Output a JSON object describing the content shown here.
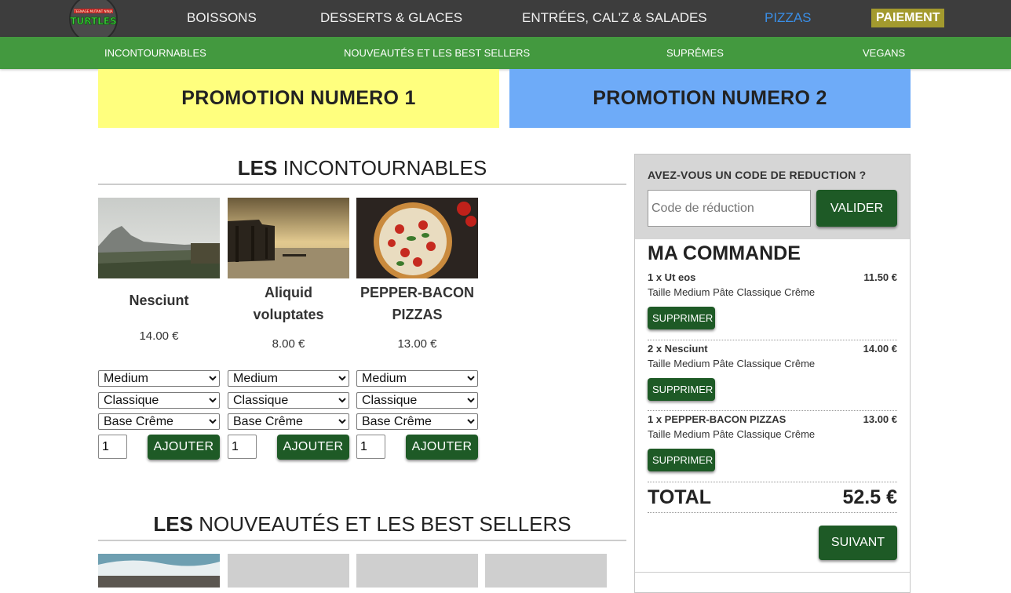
{
  "nav": {
    "items": [
      "BOISSONS",
      "DESSERTS & GLACES",
      "ENTRÉES, CAL'Z & SALADES",
      "PIZZAS"
    ],
    "active": "PIZZAS",
    "pay_label": "PAIEMENT",
    "logo_text": "TURTLES",
    "logo_subtext": "TEENAGE MUTANT NINJA"
  },
  "subnav": {
    "items": [
      "INCONTOURNABLES",
      "NOUVEAUTÉS ET LES BEST SELLERS",
      "SUPRÊMES",
      "VEGANS"
    ]
  },
  "promos": [
    "PROMOTION NUMERO 1",
    "PROMOTION NUMERO 2"
  ],
  "sections": [
    {
      "prefix": "LES",
      "name": "INCONTOURNABLES"
    },
    {
      "prefix": "LES",
      "name": "NOUVEAUTÉS ET LES BEST SELLERS"
    }
  ],
  "products": [
    {
      "name": "Nesciunt",
      "price": "14.00 €",
      "size": "Medium",
      "dough": "Classique",
      "base": "Base Crême",
      "qty": "1",
      "add_label": "AJOUTER",
      "image": "mountain-landscape"
    },
    {
      "name": "Aliquid voluptates",
      "price": "8.00 €",
      "size": "Medium",
      "dough": "Classique",
      "base": "Base Crême",
      "qty": "1",
      "add_label": "AJOUTER",
      "image": "pier-sunset"
    },
    {
      "name": "PEPPER-BACON PIZZAS",
      "price": "13.00 €",
      "size": "Medium",
      "dough": "Classique",
      "base": "Base Crême",
      "qty": "1",
      "add_label": "AJOUTER",
      "image": "pizza"
    }
  ],
  "coupon": {
    "question": "AVEZ-VOUS UN CODE DE REDUCTION ?",
    "placeholder": "Code de réduction",
    "button": "VALIDER"
  },
  "order": {
    "title": "MA COMMANDE",
    "lines": [
      {
        "title": "1 x Ut eos",
        "price": "11.50 €",
        "details": "Taille Medium Pâte Classique Crême",
        "remove": "SUPPRIMER"
      },
      {
        "title": "2 x Nesciunt",
        "price": "14.00 €",
        "details": "Taille Medium Pâte Classique Crême",
        "remove": "SUPPRIMER"
      },
      {
        "title": "1 x PEPPER-BACON PIZZAS",
        "price": "13.00 €",
        "details": "Taille Medium Pâte Classique Crême",
        "remove": "SUPPRIMER"
      }
    ],
    "total_label": "TOTAL",
    "total_value": "52.5 €",
    "next_label": "SUIVANT"
  }
}
